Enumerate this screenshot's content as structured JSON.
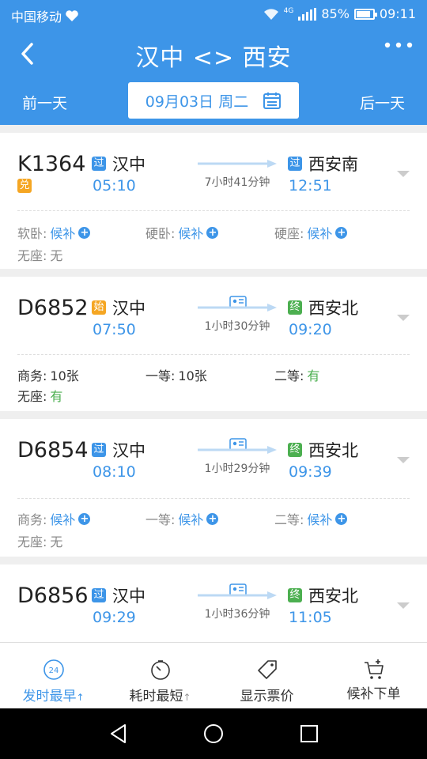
{
  "status_bar": {
    "carrier": "中国移动",
    "network": "4G",
    "battery": "85%",
    "battery_level": 0.85,
    "time": "09:11"
  },
  "header": {
    "title": "汉中 <> 西安",
    "prev_day": "前一天",
    "next_day": "后一天",
    "date": "09月03日 周二"
  },
  "trains": [
    {
      "number": "K1364",
      "tag": "兑",
      "from_badge": "过",
      "from": "汉中",
      "dep_time": "05:10",
      "duration": "7小时41分钟",
      "to_badge": "过",
      "to": "西安南",
      "arr_time": "12:51",
      "seats": [
        {
          "label": "软卧:",
          "value": "候补"
        },
        {
          "label": "硬卧:",
          "value": "候补"
        },
        {
          "label": "硬座:",
          "value": "候补"
        },
        {
          "label": "无座:",
          "value": "无"
        }
      ]
    },
    {
      "number": "D6852",
      "from_badge": "始",
      "from": "汉中",
      "dep_time": "07:50",
      "duration": "1小时30分钟",
      "to_badge": "终",
      "to": "西安北",
      "arr_time": "09:20",
      "seats": [
        {
          "label": "商务:",
          "value": "10张"
        },
        {
          "label": "一等:",
          "value": "10张"
        },
        {
          "label": "二等:",
          "value": "有"
        },
        {
          "label": "无座:",
          "value": "有"
        }
      ]
    },
    {
      "number": "D6854",
      "from_badge": "过",
      "from": "汉中",
      "dep_time": "08:10",
      "duration": "1小时29分钟",
      "to_badge": "终",
      "to": "西安北",
      "arr_time": "09:39",
      "seats": [
        {
          "label": "商务:",
          "value": "候补"
        },
        {
          "label": "一等:",
          "value": "候补"
        },
        {
          "label": "二等:",
          "value": "候补"
        },
        {
          "label": "无座:",
          "value": "无"
        }
      ]
    },
    {
      "number": "D6856",
      "from_badge": "过",
      "from": "汉中",
      "dep_time": "09:29",
      "duration": "1小时36分钟",
      "to_badge": "终",
      "to": "西安北",
      "arr_time": "11:05"
    }
  ],
  "toolbar": {
    "earliest": "发时最早",
    "earliest_icon_text": "24",
    "shortest": "耗时最短",
    "show_price": "显示票价",
    "waitlist_order": "候补下单"
  },
  "colors": {
    "accent": "#3d95e8",
    "green": "#4caf50",
    "orange": "#f5a623"
  }
}
